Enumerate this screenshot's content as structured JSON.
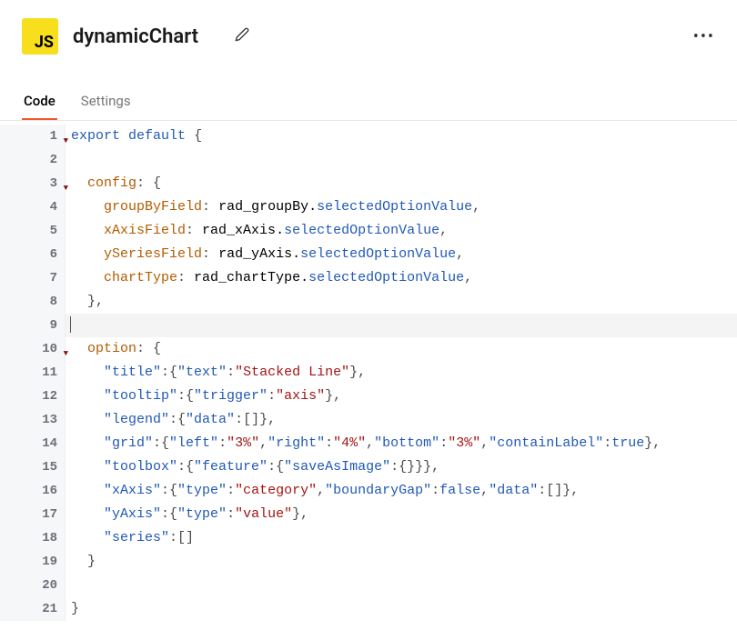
{
  "header": {
    "badge": "JS",
    "title": "dynamicChart",
    "menu": "•••"
  },
  "tabs": {
    "code": "Code",
    "settings": "Settings"
  },
  "lines": {
    "l1": {
      "num": "1"
    },
    "l2": {
      "num": "2"
    },
    "l3": {
      "num": "3"
    },
    "l4": {
      "num": "4"
    },
    "l5": {
      "num": "5"
    },
    "l6": {
      "num": "6"
    },
    "l7": {
      "num": "7"
    },
    "l8": {
      "num": "8"
    },
    "l9": {
      "num": "9"
    },
    "l10": {
      "num": "10"
    },
    "l11": {
      "num": "11"
    },
    "l12": {
      "num": "12"
    },
    "l13": {
      "num": "13"
    },
    "l14": {
      "num": "14"
    },
    "l15": {
      "num": "15"
    },
    "l16": {
      "num": "16"
    },
    "l17": {
      "num": "17"
    },
    "l18": {
      "num": "18"
    },
    "l19": {
      "num": "19"
    },
    "l20": {
      "num": "20"
    },
    "l21": {
      "num": "21"
    }
  },
  "code": {
    "export_kw": "export",
    "default_kw": "default",
    "config_key": "config",
    "groupByField": "groupByField",
    "xAxisField": "xAxisField",
    "ySeriesField": "ySeriesField",
    "chartType": "chartType",
    "rad_groupBy": "rad_groupBy",
    "rad_xAxis": "rad_xAxis",
    "rad_yAxis": "rad_yAxis",
    "rad_chartType": "rad_chartType",
    "selectedOptionValue": "selectedOptionValue",
    "option_key": "option",
    "title_k": "\"title\"",
    "text_k": "\"text\"",
    "stacked_line": "\"Stacked Line\"",
    "tooltip_k": "\"tooltip\"",
    "trigger_k": "\"trigger\"",
    "axis_v": "\"axis\"",
    "legend_k": "\"legend\"",
    "data_k": "\"data\"",
    "grid_k": "\"grid\"",
    "left_k": "\"left\"",
    "p3": "\"3%\"",
    "right_k": "\"right\"",
    "p4": "\"4%\"",
    "bottom_k": "\"bottom\"",
    "containLabel_k": "\"containLabel\"",
    "true_v": "true",
    "toolbox_k": "\"toolbox\"",
    "feature_k": "\"feature\"",
    "saveAsImage_k": "\"saveAsImage\"",
    "xAxis_k": "\"xAxis\"",
    "type_k": "\"type\"",
    "category_v": "\"category\"",
    "boundaryGap_k": "\"boundaryGap\"",
    "false_v": "false",
    "yAxis_k": "\"yAxis\"",
    "value_v": "\"value\"",
    "series_k": "\"series\""
  }
}
